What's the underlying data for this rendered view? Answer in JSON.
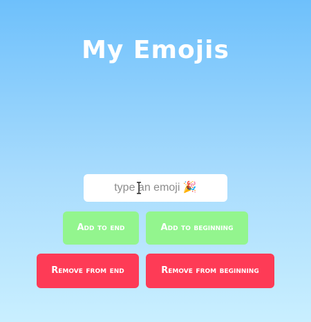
{
  "header": {
    "title": "My Emojis"
  },
  "emoji_list": {
    "items": []
  },
  "input": {
    "placeholder": "type an emoji 🎉",
    "value": ""
  },
  "buttons": {
    "add_to_end": "Add to end",
    "add_to_beginning": "Add to beginning",
    "remove_from_end": "Remove from end",
    "remove_from_beginning": "Remove from beginning"
  },
  "colors": {
    "background_top": "#6ec0fb",
    "background_bottom": "#c9efff",
    "add_button": "#93f58e",
    "remove_button": "#fe3b56",
    "title_text": "#ffffff"
  },
  "icons": {
    "cursor": "text-cursor-icon"
  }
}
